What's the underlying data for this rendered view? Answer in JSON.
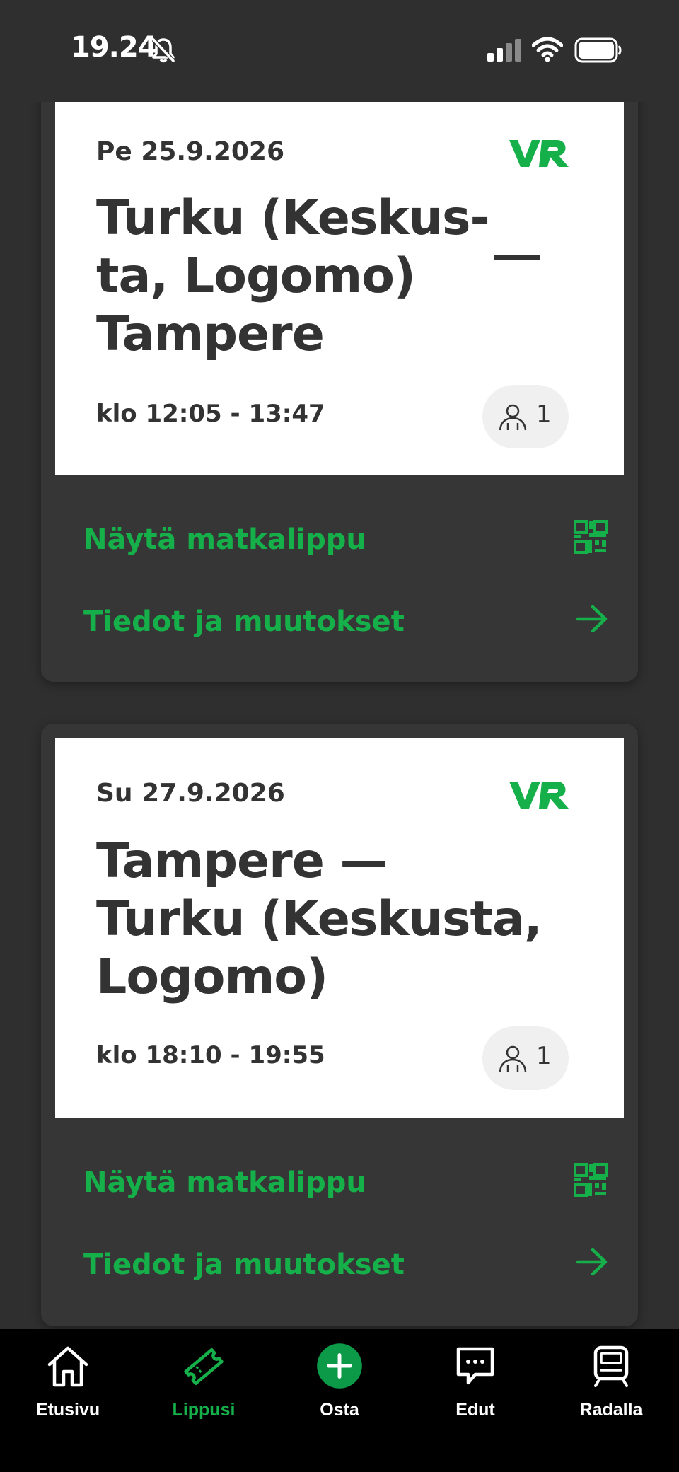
{
  "status_bar": {
    "time": "19.24",
    "icons": [
      "bell-slash-icon",
      "signal-icon",
      "wifi-icon",
      "battery-icon"
    ]
  },
  "tickets": [
    {
      "date": "Pe 25.9.2026",
      "logo": "VR",
      "route_lines": [
        "Turku (Keskus-",
        "ta, Logomo)",
        "Tampere"
      ],
      "time": "klo 12:05 - 13:47",
      "passengers": "1",
      "show_ticket_label": "Näytä matkalippu",
      "details_label": "Tiedot ja muutokset"
    },
    {
      "date": "Su 27.9.2026",
      "logo": "VR",
      "route_lines": [
        "Tampere —",
        "Turku (Keskusta,",
        "Logomo)"
      ],
      "time": "klo 18:10 - 19:55",
      "passengers": "1",
      "show_ticket_label": "Näytä matkalippu",
      "details_label": "Tiedot ja muutokset"
    }
  ],
  "bottom_nav": {
    "items": [
      {
        "label": "Etusivu",
        "icon": "home-icon"
      },
      {
        "label": "Lippusi",
        "icon": "ticket-icon",
        "active": true
      },
      {
        "label": "Osta",
        "icon": "plus-circle-icon"
      },
      {
        "label": "Edut",
        "icon": "chat-bubble-icon"
      },
      {
        "label": "Radalla",
        "icon": "train-icon"
      }
    ]
  },
  "colors": {
    "background": "#2f2f2f",
    "panel": "#363636",
    "card": "#ffffff",
    "accent_green": "#16b04a",
    "nav_background": "#000000"
  }
}
